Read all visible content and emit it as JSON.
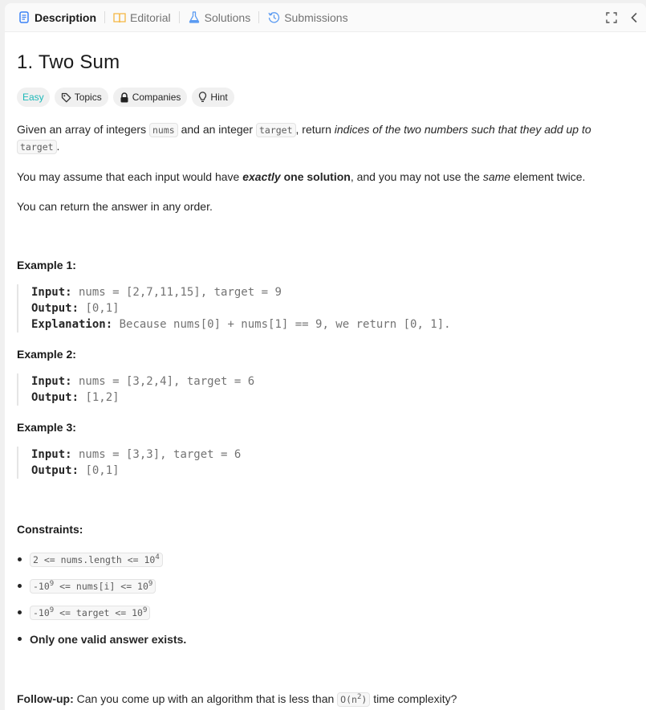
{
  "tabs": [
    {
      "label": "Description",
      "icon": "description-icon",
      "active": true
    },
    {
      "label": "Editorial",
      "icon": "book-icon"
    },
    {
      "label": "Solutions",
      "icon": "flask-icon"
    },
    {
      "label": "Submissions",
      "icon": "history-icon"
    }
  ],
  "problem": {
    "title": "1. Two Sum",
    "difficulty": "Easy",
    "chips": {
      "topics": "Topics",
      "companies": "Companies",
      "hint": "Hint"
    },
    "desc1": {
      "a": "Given an array of integers ",
      "code1": "nums",
      "b": " and an integer ",
      "code2": "target",
      "c": ", return ",
      "italic": "indices of the two numbers such that they add up to",
      "d": " ",
      "code3": "target",
      "e": "."
    },
    "desc2": {
      "a": "You may assume that each input would have ",
      "bold_italic": "exactly",
      "bold": " one solution",
      "b": ", and you may not use the ",
      "italic": "same",
      "c": " element twice."
    },
    "desc3": "You can return the answer in any order."
  },
  "examples": [
    {
      "heading": "Example 1:",
      "input_label": "Input:",
      "input": " nums = [2,7,11,15], target = 9",
      "output_label": "Output:",
      "output": " [0,1]",
      "expl_label": "Explanation:",
      "explanation": " Because nums[0] + nums[1] == 9, we return [0, 1]."
    },
    {
      "heading": "Example 2:",
      "input_label": "Input:",
      "input": " nums = [3,2,4], target = 6",
      "output_label": "Output:",
      "output": " [1,2]"
    },
    {
      "heading": "Example 3:",
      "input_label": "Input:",
      "input": " nums = [3,3], target = 6",
      "output_label": "Output:",
      "output": " [0,1]"
    }
  ],
  "constraints": {
    "heading": "Constraints:",
    "c1": {
      "a": "2 <= nums.length <= 10",
      "sup": "4"
    },
    "c2": {
      "a": "-10",
      "sup1": "9",
      "b": " <= nums[i] <= 10",
      "sup2": "9"
    },
    "c3": {
      "a": "-10",
      "sup1": "9",
      "b": " <= target <= 10",
      "sup2": "9"
    },
    "c4": "Only one valid answer exists."
  },
  "followup": {
    "label": "Follow-up:",
    "a": " Can you come up with an algorithm that is less than ",
    "code": "O(n",
    "sup": "2",
    "code_end": ")",
    "b": " time complexity?"
  },
  "colors": {
    "easy": "#1cb8b8",
    "description_icon": "#3b82f6",
    "editorial_icon": "#f5b642",
    "solutions_icon": "#5b9bf2"
  }
}
